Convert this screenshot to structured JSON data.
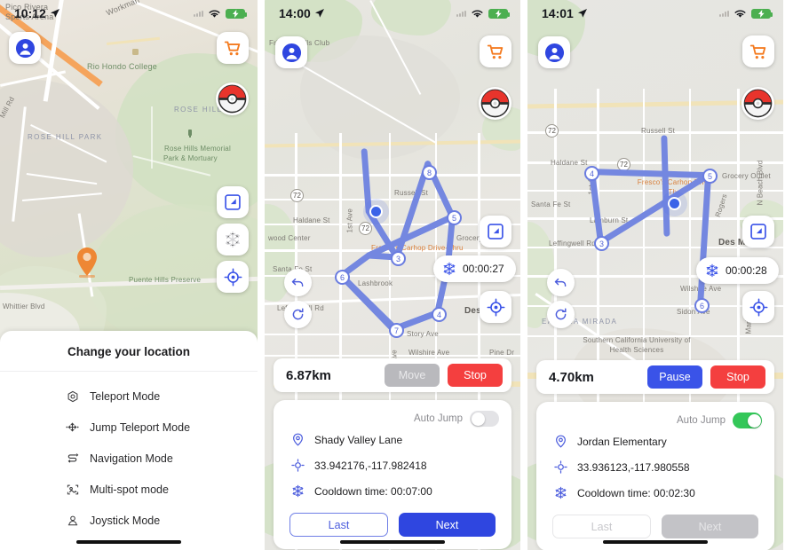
{
  "screens": [
    {
      "id": "screen-teleport-menu",
      "status": {
        "time": "10:12",
        "location_arrow": true,
        "wifi": "wifi-icon",
        "battery": "battery-charging-icon"
      },
      "map": {
        "labels": [
          "Pico Rivera",
          "Sports Arena",
          "Workman",
          "Rio Hondo College",
          "ROSE HILL",
          "ROSE HILL PARK",
          "Rose Hills Memorial",
          "Park & Mortuary",
          "Puente Hills Preserve",
          "Whittier Blvd",
          "Mill Rd"
        ],
        "pin": "orange-location-pin"
      },
      "buttons": {
        "avatar": "avatar-icon",
        "cart": "cart-icon",
        "pokeball": "pokeball-icon",
        "edit": "edit-square-icon",
        "snowflake": "snowflake-icon",
        "target": "crosshair-icon"
      },
      "sheet": {
        "title": "Change your location",
        "items": [
          {
            "label": "Teleport Mode",
            "icon": "teleport-icon"
          },
          {
            "label": "Jump Teleport Mode",
            "icon": "jump-teleport-icon"
          },
          {
            "label": "Navigation Mode",
            "icon": "navigation-route-icon"
          },
          {
            "label": "Multi-spot mode",
            "icon": "multi-spot-icon"
          },
          {
            "label": "Joystick Mode",
            "icon": "joystick-person-icon"
          }
        ]
      }
    },
    {
      "id": "screen-route-running",
      "status": {
        "time": "14:00",
        "location_arrow": true,
        "wifi": "wifi-icon",
        "battery": "battery-charging-icon"
      },
      "map": {
        "labels": [
          "Friendly Hills Club",
          "Russell St",
          "Haldane St",
          "Santa Fe St",
          "Lashbrook",
          "Leffingwell Rd",
          "Grocery",
          "Story Ave",
          "Wilshire Ave",
          "Pine Dr",
          "Des",
          "1st Ave",
          "Fresco's Carhop Drive-Thru",
          "wood Center",
          "Ave"
        ],
        "waypoints": [
          "8",
          "5",
          "6",
          "3",
          "4",
          "7"
        ],
        "shields": [
          "72",
          "72"
        ]
      },
      "timer": {
        "icon": "snowflake-icon",
        "value": "00:00:27"
      },
      "buttons": {
        "avatar": "avatar-icon",
        "cart": "cart-icon",
        "pokeball": "pokeball-icon",
        "edit": "edit-square-icon",
        "target": "crosshair-icon",
        "undo": "undo-arrow-icon",
        "refresh": "refresh-icon"
      },
      "distance_bar": {
        "distance": "6.87km",
        "primary_label": "Move",
        "primary_enabled": false,
        "stop_label": "Stop"
      },
      "info": {
        "auto_jump_label": "Auto Jump",
        "auto_jump_on": false,
        "place": "Shady Valley Lane",
        "coords": "33.942176,-117.982418",
        "cooldown": "Cooldown time: 00:07:00",
        "place_icon": "map-pin-icon",
        "coords_icon": "coordinates-icon",
        "cooldown_icon": "snowflake-icon",
        "last_label": "Last",
        "next_label": "Next",
        "last_enabled": true,
        "next_enabled": true
      }
    },
    {
      "id": "screen-route-paused",
      "status": {
        "time": "14:01",
        "location_arrow": true,
        "wifi": "wifi-icon",
        "battery": "battery-charging-icon"
      },
      "map": {
        "labels": [
          "Russell St",
          "Haldane St",
          "Santa Fe St",
          "Lamburn St",
          "Leffingwell Rd",
          "Grocery Outlet",
          "N Beach Blvd",
          "Des Mo",
          "Wilshire Ave",
          "Sidon Ave",
          "EAST LA MIRADA",
          "Southern California University of Health Sciences",
          "Fresco's Carhop Drive-Thru",
          "1st Ave",
          "Mariposa",
          "Rogers"
        ],
        "waypoints": [
          "4",
          "5",
          "3",
          "6"
        ],
        "shields": [
          "72",
          "72"
        ]
      },
      "timer": {
        "icon": "snowflake-icon",
        "value": "00:00:28"
      },
      "buttons": {
        "avatar": "avatar-icon",
        "cart": "cart-icon",
        "pokeball": "pokeball-icon",
        "edit": "edit-square-icon",
        "target": "crosshair-icon",
        "undo": "undo-arrow-icon",
        "refresh": "refresh-icon"
      },
      "distance_bar": {
        "distance": "4.70km",
        "primary_label": "Pause",
        "primary_enabled": true,
        "stop_label": "Stop"
      },
      "info": {
        "auto_jump_label": "Auto Jump",
        "auto_jump_on": true,
        "place": "Jordan Elementary",
        "coords": "33.936123,-117.980558",
        "cooldown": "Cooldown time: 00:02:30",
        "place_icon": "map-pin-icon",
        "coords_icon": "coordinates-icon",
        "cooldown_icon": "snowflake-icon",
        "last_label": "Last",
        "next_label": "Next",
        "last_enabled": false,
        "next_enabled": false
      }
    }
  ],
  "colors": {
    "accent_blue": "#3a53e8",
    "route_blue": "#7487e0",
    "stop_red": "#f43f3f",
    "toggle_green": "#34c759",
    "pin_orange": "#ee8734"
  }
}
